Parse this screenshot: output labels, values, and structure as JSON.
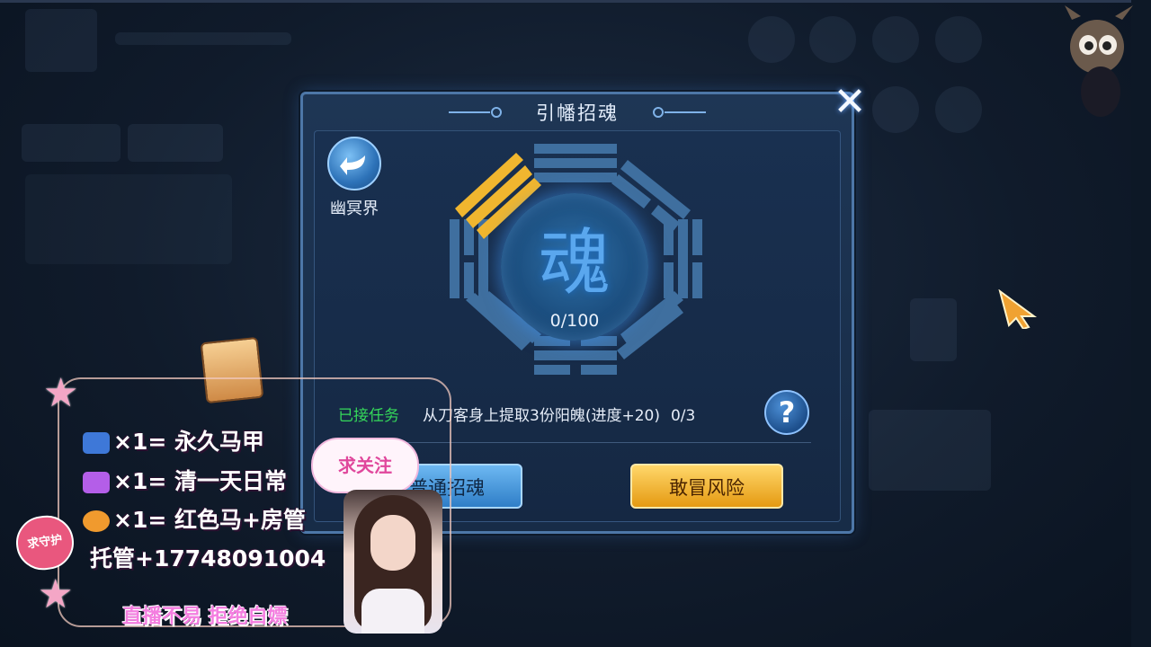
{
  "dialog": {
    "title": "引幡招魂",
    "close_glyph": "✕",
    "back_label": "幽冥界",
    "soul_glyph": "魂",
    "progress": "0/100",
    "task": {
      "tag": "已接任务",
      "description": "从刀客身上提取3份阳魄(进度+20)",
      "count": "0/3"
    },
    "help_glyph": "?",
    "buttons": {
      "normal": "普通招魂",
      "risk": "敢冒风险"
    }
  },
  "overlay": {
    "lines": [
      {
        "icon": "badge-icon",
        "text": "×1= 永久马甲"
      },
      {
        "icon": "feather-icon",
        "text": "×1= 清一天日常"
      },
      {
        "icon": "flame-icon",
        "text": "×1= 红色马+房管"
      },
      {
        "icon": "",
        "text": "托管+17748091004"
      }
    ],
    "follow": "求关注",
    "guard": "求守护",
    "banner": "直播不易  拒绝白嫖"
  }
}
